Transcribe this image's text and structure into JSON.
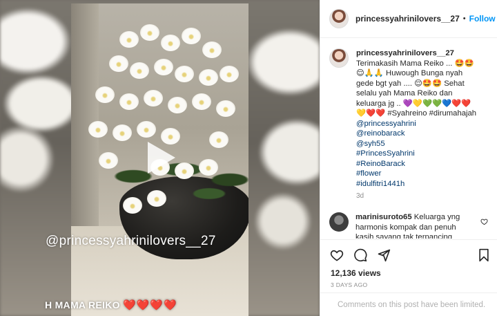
{
  "media": {
    "watermark": "@princessyahrinilovers__27",
    "caption": "H MAMA REIKO",
    "caption_hearts": "❤️❤️❤️❤️",
    "play_icon": "play-icon"
  },
  "header": {
    "username": "princessyahrinilovers__27",
    "separator": "•",
    "follow_label": "Follow"
  },
  "caption": {
    "username": "princessyahrinilovers__27",
    "lines": [
      "Terimakasih Mama Reiko ... 🤩🤩",
      "😌🙏🙏 Huwough Bunga nyah",
      "gede bgt yah .... 😌🤩🤩 Sehat",
      "selalu yah Mama Reiko dan",
      "keluarga jg .. 💜💛💚💚💙❤️❤️",
      "💛❤️❤️ #Syahreino #dirumahajah"
    ],
    "tags": [
      "@princessyahrini",
      "@reinobarack",
      "@syh55",
      "#PrincesSyahrini",
      "#ReinoBarack",
      "#flower",
      "#idulfitri1441h"
    ],
    "time": "3d"
  },
  "comment": {
    "username": "marinisuroto65",
    "text": "Keluarga yng harmonis kompak dan penuh kasih sayang tak terpancing"
  },
  "actions": {
    "views": "12,136 views",
    "posted": "3 DAYS AGO",
    "comments_limited": "Comments on this post have been limited."
  },
  "colors": {
    "follow_blue": "#0095f6",
    "tag_blue": "#00376b",
    "muted": "#8e8e8e"
  }
}
